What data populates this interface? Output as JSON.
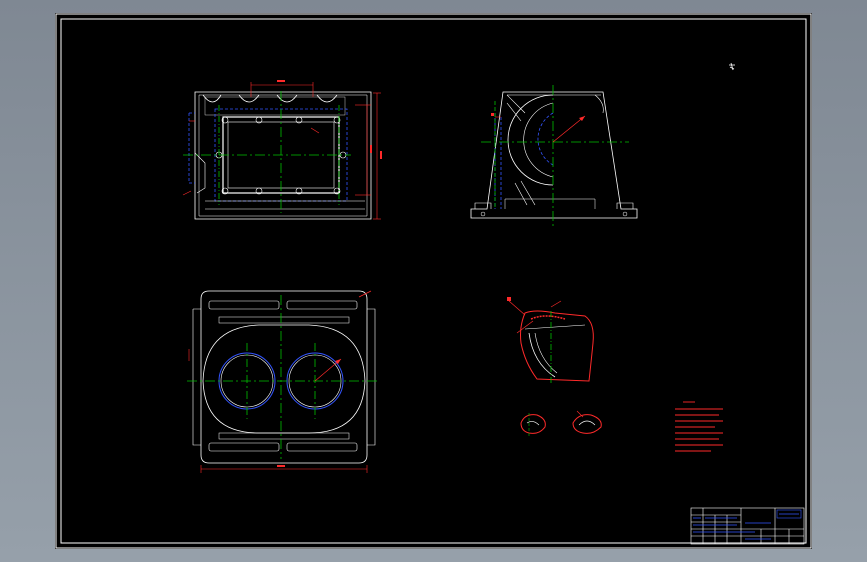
{
  "drawing": {
    "background_color": "#000000",
    "viewport_color": "#8a939d",
    "colors": {
      "outline": "#ffffff",
      "center_line": "#00c000",
      "hidden_line": "#3355ff",
      "dimension": "#ff2a2a",
      "technical_requirements": "#ff2a2a"
    }
  },
  "views": [
    {
      "name": "top-view"
    },
    {
      "name": "side-view"
    },
    {
      "name": "bottom-view"
    },
    {
      "name": "detail-section-view"
    },
    {
      "name": "detail-view-small-1"
    },
    {
      "name": "detail-view-small-2"
    }
  ],
  "title_block": {
    "present": true
  }
}
